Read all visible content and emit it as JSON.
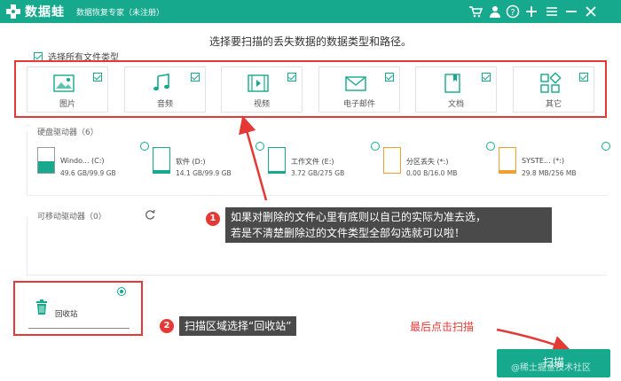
{
  "app": {
    "name": "数据蛙",
    "subtitle": "数据恢复专家（未注册）"
  },
  "titlebar_icons": [
    "cart-icon",
    "user-icon",
    "help-icon",
    "plus-icon",
    "menu-icon",
    "minimize-icon",
    "close-icon"
  ],
  "prompt": "选择要扫描的丢失数据的数据类型和路径。",
  "select_all_label": "选择所有文件类型",
  "file_types": [
    {
      "label": "图片",
      "icon": "image-icon"
    },
    {
      "label": "音频",
      "icon": "music-icon"
    },
    {
      "label": "视频",
      "icon": "video-icon"
    },
    {
      "label": "电子邮件",
      "icon": "email-icon"
    },
    {
      "label": "文档",
      "icon": "document-icon"
    },
    {
      "label": "其它",
      "icon": "other-icon"
    }
  ],
  "hard_drives": {
    "title": "硬盘驱动器（6）",
    "drives": [
      {
        "name": "Windo... (C:)",
        "size": "49.6 GB/99.9 GB"
      },
      {
        "name": "软件 (D:)",
        "size": "14.1 GB/99.9 GB"
      },
      {
        "name": "工作文件 (E:)",
        "size": "3.72 GB/275 GB"
      },
      {
        "name": "分区丢失 (*:)",
        "size": "0.00  B/16.0 MB"
      },
      {
        "name": "SYSTE... (*:)",
        "size": "29.8 MB/256 MB"
      }
    ]
  },
  "removable": {
    "title": "可移动驱动器（0）"
  },
  "recycle_bin": {
    "label": "回收站"
  },
  "callouts": {
    "one": {
      "number": "1",
      "line1": "如果对删除的文件心里有底则以自己的实际为准去选，",
      "line2": "若是不清楚删除过的文件类型全部勾选就可以啦！"
    },
    "two": {
      "number": "2",
      "text": "扫描区域选择“回收站”"
    },
    "final": "最后点击扫描"
  },
  "scan_button": "扫描",
  "watermark": "@稀土掘金技术社区",
  "colors": {
    "brand": "#17a98e",
    "annotation": "#e53935",
    "callout_bg": "#4a4a4a"
  }
}
